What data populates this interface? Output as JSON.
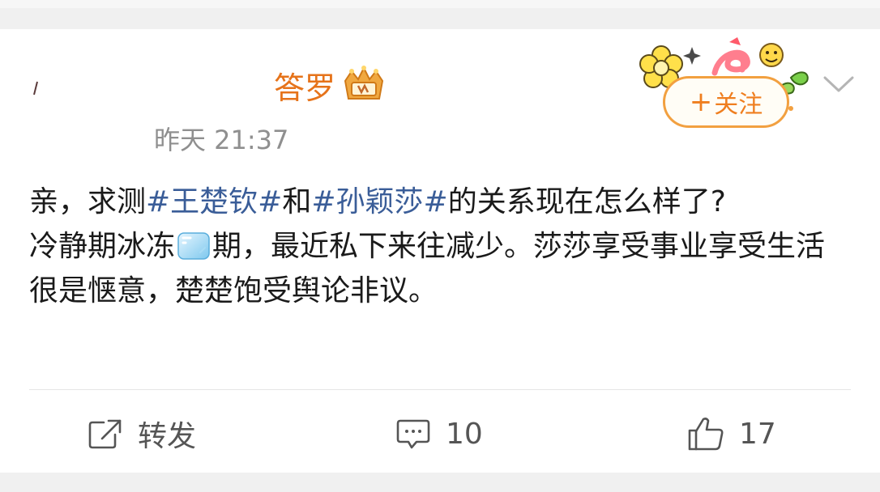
{
  "post": {
    "username_visible": "答罗",
    "badge_icon": "crown-badge-icon",
    "time": "昨天 21:37",
    "follow_label": "+关注",
    "follow_plus": "+",
    "follow_text": "关注",
    "body": {
      "line1_prefix": "亲，求测",
      "hashtag1": "#王楚钦#",
      "mid": "和",
      "hashtag2": "#孙颖莎#",
      "line1_suffix": "的关系现在怎么样了?",
      "line2_before_emoji": "冷静期冰冻",
      "emoji": "ice-cube-emoji",
      "line2_after_emoji": "期，最近私下来往减少。莎莎享受事业享受生活很是惬意，楚楚饱受舆论非议。"
    }
  },
  "actions": {
    "repost_label": "转发",
    "comment_count": "10",
    "like_count": "17"
  },
  "colors": {
    "hashtag": "#3a5d98",
    "username": "#e6731a",
    "follow_border": "#f2a040",
    "follow_text": "#ef7e1f",
    "meta_text": "#8f8f8f"
  }
}
